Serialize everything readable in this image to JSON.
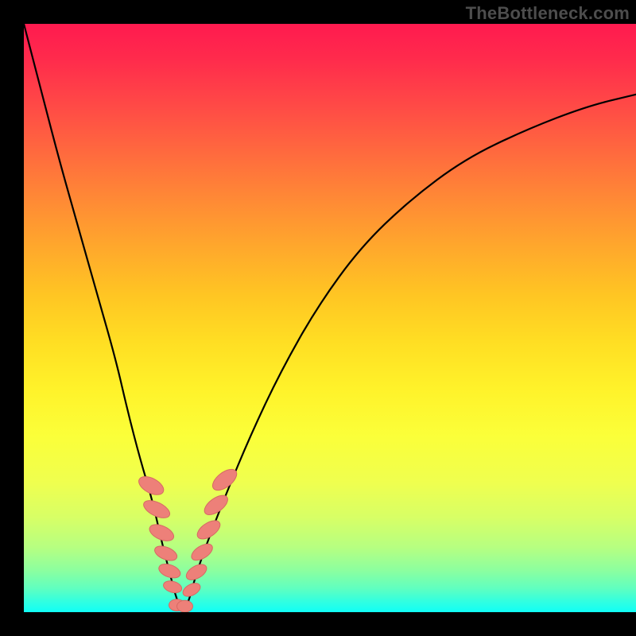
{
  "watermark": "TheBottleneck.com",
  "colors": {
    "curve_stroke": "#000000",
    "bead_fill": "#ed8079",
    "bead_stroke": "#d66a63",
    "frame": "#000000"
  },
  "chart_data": {
    "type": "line",
    "title": "",
    "xlabel": "",
    "ylabel": "",
    "xlim": [
      0,
      100
    ],
    "ylim": [
      0,
      100
    ],
    "grid": false,
    "series": [
      {
        "name": "curve",
        "x": [
          0,
          3,
          6,
          9,
          12,
          15,
          17,
          19,
          21,
          22.5,
          24,
          25,
          26,
          27,
          28,
          30,
          33,
          37,
          42,
          48,
          55,
          63,
          72,
          82,
          92,
          100
        ],
        "y": [
          100,
          88,
          76,
          65,
          54,
          43,
          34,
          26,
          19,
          12,
          6,
          2,
          0,
          2,
          6,
          12,
          20,
          30,
          41,
          52,
          62,
          70,
          77,
          82,
          86,
          88
        ]
      }
    ],
    "beads_left": [
      {
        "x": 20.8,
        "y": 21.5,
        "rx": 1.2,
        "ry": 2.3,
        "rot": -62
      },
      {
        "x": 21.7,
        "y": 17.5,
        "rx": 1.1,
        "ry": 2.4,
        "rot": -64
      },
      {
        "x": 22.5,
        "y": 13.5,
        "rx": 1.1,
        "ry": 2.2,
        "rot": -66
      },
      {
        "x": 23.2,
        "y": 10.0,
        "rx": 1.0,
        "ry": 2.0,
        "rot": -68
      },
      {
        "x": 23.8,
        "y": 7.0,
        "rx": 1.0,
        "ry": 1.9,
        "rot": -70
      },
      {
        "x": 24.3,
        "y": 4.3,
        "rx": 0.9,
        "ry": 1.6,
        "rot": -74
      }
    ],
    "beads_bottom": [
      {
        "x": 25.0,
        "y": 1.2,
        "rx": 1.3,
        "ry": 1.0,
        "rot": 0
      },
      {
        "x": 26.3,
        "y": 1.0,
        "rx": 1.3,
        "ry": 1.0,
        "rot": 0
      }
    ],
    "beads_right": [
      {
        "x": 27.4,
        "y": 3.8,
        "rx": 0.9,
        "ry": 1.6,
        "rot": 62
      },
      {
        "x": 28.2,
        "y": 6.8,
        "rx": 1.0,
        "ry": 1.9,
        "rot": 60
      },
      {
        "x": 29.1,
        "y": 10.2,
        "rx": 1.0,
        "ry": 2.0,
        "rot": 58
      },
      {
        "x": 30.2,
        "y": 14.0,
        "rx": 1.1,
        "ry": 2.2,
        "rot": 56
      },
      {
        "x": 31.4,
        "y": 18.2,
        "rx": 1.1,
        "ry": 2.3,
        "rot": 54
      },
      {
        "x": 32.8,
        "y": 22.5,
        "rx": 1.2,
        "ry": 2.4,
        "rot": 52
      }
    ]
  }
}
